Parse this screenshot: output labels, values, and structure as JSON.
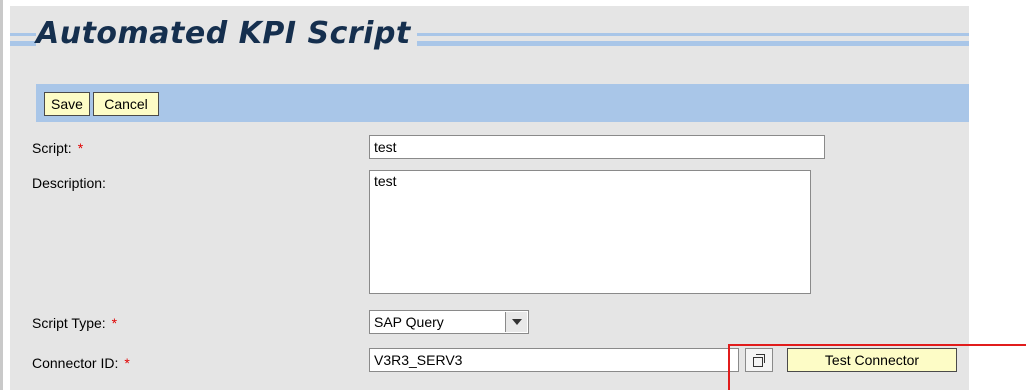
{
  "header": {
    "title": "Automated KPI Script"
  },
  "toolbar": {
    "save_label": "Save",
    "cancel_label": "Cancel"
  },
  "form": {
    "required_marker": "*",
    "script": {
      "label": "Script:",
      "value": "test"
    },
    "description": {
      "label": "Description:",
      "value": "test"
    },
    "script_type": {
      "label": "Script Type:",
      "selected": "SAP Query"
    },
    "connector_id": {
      "label": "Connector ID:",
      "value": "V3R3_SERV3",
      "test_button": "Test Connector"
    }
  },
  "colors": {
    "toolbar_bg": "#a9c6e8",
    "button_bg": "#fdfcc6",
    "title_text": "#152f4e",
    "required": "#e00000",
    "highlight": "#e11c1c"
  },
  "icons": {
    "browse": "value-help-icon",
    "dropdown": "chevron-down-icon"
  }
}
